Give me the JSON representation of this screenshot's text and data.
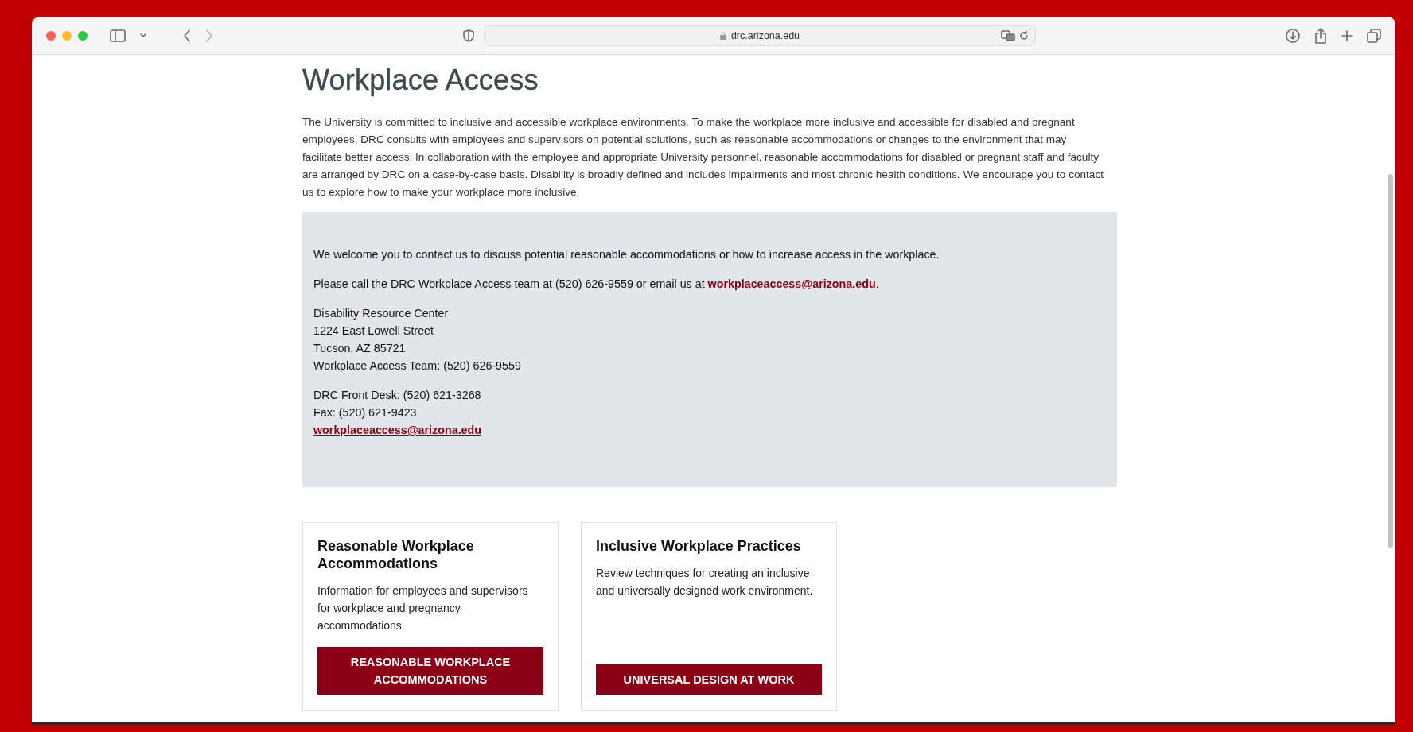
{
  "browser": {
    "url": "drc.arizona.edu"
  },
  "page": {
    "heading": "Workplace Access",
    "intro": "The University is committed to inclusive and accessible workplace environments. To make the workplace more inclusive and accessible for disabled and pregnant employees, DRC consults with employees and supervisors on potential solutions, such as reasonable accommodations or changes to the environment that may facilitate better access. In collaboration with the employee and appropriate University personnel, reasonable accommodations for disabled or pregnant staff and faculty are arranged by DRC on a case-by-case basis. Disability is broadly defined and includes impairments and most chronic health conditions. We encourage you to contact us to explore how to make your workplace more inclusive.",
    "contact": {
      "welcome": "We welcome you to contact us to discuss potential reasonable accommodations or how to increase access in the workplace.",
      "call_text": "Please call the DRC Workplace Access team at (520) 626-9559 or email us at",
      "call_link": "workplaceaccess@arizona.edu",
      "call_end": ".",
      "address": [
        "Disability Resource Center",
        "1224 East Lowell Street",
        "Tucson, AZ 85721",
        "Workplace Access Team: (520) 626-9559"
      ],
      "desk": [
        "DRC Front Desk: (520) 621-3268",
        "Fax: (520) 621-9423"
      ],
      "email_link": "workplaceaccess@arizona.edu"
    },
    "cards": [
      {
        "title": "Reasonable Workplace Accommodations",
        "text": "Information for employees and supervisors for workplace and pregnancy accommodations.",
        "button": "REASONABLE WORKPLACE ACCOMMODATIONS"
      },
      {
        "title": "Inclusive Workplace Practices",
        "text": "Review techniques for creating an inclusive and universally designed work environment.",
        "button": "UNIVERSAL DESIGN AT WORK"
      }
    ]
  }
}
